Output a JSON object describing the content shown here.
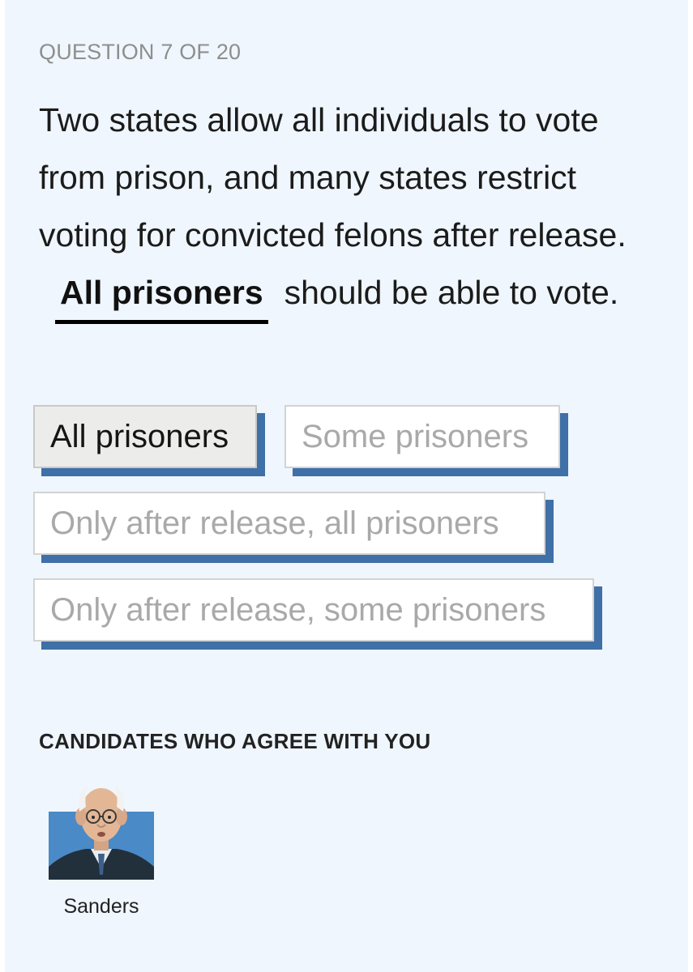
{
  "quiz": {
    "progress_label": "QUESTION 7 OF 20",
    "question": {
      "before": "Two states allow all individuals to vote from prison, and many states restrict voting for convicted felons after release.",
      "blank_answer": "All prisoners",
      "after": "should be able to vote."
    },
    "options": [
      {
        "label": "All prisoners",
        "selected": true
      },
      {
        "label": "Some prisoners",
        "selected": false
      },
      {
        "label": "Only after release, all prisoners",
        "selected": false
      },
      {
        "label": "Only after release, some prisoners",
        "selected": false
      }
    ],
    "shadow_color": "#3f70a7",
    "background_color": "#eff6fd"
  },
  "candidates": {
    "heading": "CANDIDATES WHO AGREE WITH YOU",
    "list": [
      {
        "name": "Sanders",
        "portrait_icon": "candidate-portrait-illustration"
      }
    ]
  }
}
